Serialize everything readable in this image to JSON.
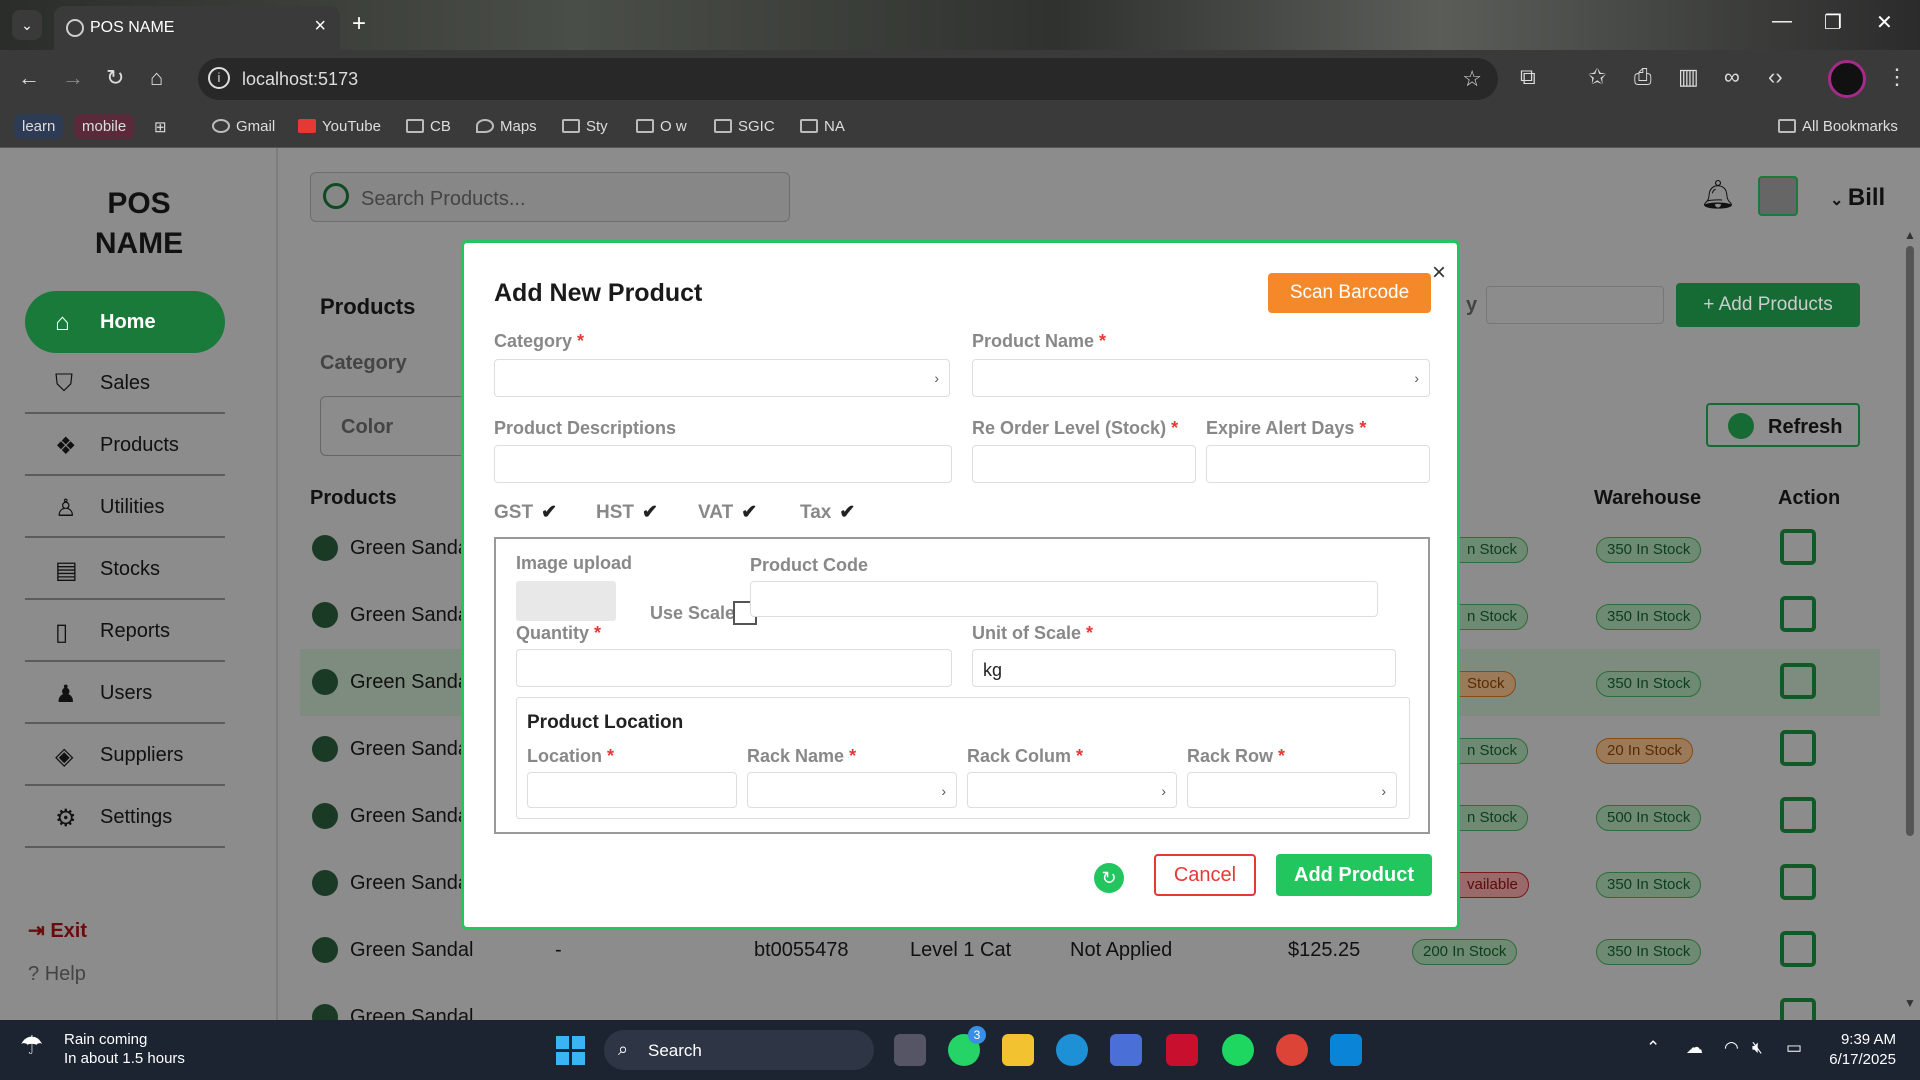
{
  "browser": {
    "tab_title": "POS NAME",
    "url": "localhost:5173",
    "bookmarks": [
      "learn",
      "mobile",
      "Gmail",
      "YouTube",
      "CB",
      "Maps",
      "Sty",
      "O w",
      "SGIC",
      "NA"
    ],
    "all_bookmarks": "All Bookmarks"
  },
  "app": {
    "logo": "POS NAME",
    "search_placeholder": "Search Products...",
    "user": "Bill",
    "nav": [
      "Home",
      "Sales",
      "Products",
      "Utilities",
      "Stocks",
      "Reports",
      "Users",
      "Suppliers",
      "Settings"
    ],
    "exit": "Exit",
    "help": "Help",
    "products_title": "Products",
    "category_label": "Category",
    "color_label": "Color",
    "add_products": "+ Add Products",
    "refresh": "Refresh",
    "filter_suffix": "y",
    "table": {
      "headers": {
        "products": "Products",
        "warehouse": "Warehouse",
        "action": "Action"
      },
      "rows": [
        {
          "name": "Green Sanda",
          "stock": "n Stock",
          "stock_status": "ok",
          "warehouse": "350 In Stock",
          "wh_status": "ok"
        },
        {
          "name": "Green Sanda",
          "stock": "n Stock",
          "stock_status": "ok",
          "warehouse": "350 In Stock",
          "wh_status": "ok"
        },
        {
          "name": "Green Sanda",
          "stock": "Stock",
          "stock_status": "warn",
          "warehouse": "350 In Stock",
          "wh_status": "ok"
        },
        {
          "name": "Green Sanda",
          "stock": "n Stock",
          "stock_status": "ok",
          "warehouse": "20 In Stock",
          "wh_status": "warn"
        },
        {
          "name": "Green Sanda",
          "stock": "n Stock",
          "stock_status": "ok",
          "warehouse": "500 In Stock",
          "wh_status": "ok"
        },
        {
          "name": "Green Sanda",
          "stock": "vailable",
          "stock_status": "bad",
          "warehouse": "350 In Stock",
          "wh_status": "ok"
        },
        {
          "name": "Green Sandal",
          "stock": "200 In Stock",
          "stock_status": "ok",
          "warehouse": "350 In Stock",
          "wh_status": "ok",
          "desc": "-",
          "code": "bt0055478",
          "category": "Level 1 Cat",
          "tax": "Not Applied",
          "price": "$125.25"
        },
        {
          "name": "Green Sandal"
        }
      ]
    }
  },
  "modal": {
    "title": "Add New Product",
    "scan_barcode": "Scan Barcode",
    "close": "×",
    "fields": {
      "category": "Category",
      "product_name": "Product Name",
      "descriptions": "Product Descriptions",
      "reorder": "Re Order Level (Stock)",
      "expire": "Expire Alert Days",
      "image_upload": "Image upload",
      "use_scale": "Use Scale",
      "product_code": "Product Code",
      "quantity": "Quantity",
      "unit_of_scale": "Unit of Scale",
      "unit_value": "kg",
      "location_title": "Product Location",
      "location": "Location",
      "rack_name": "Rack Name",
      "rack_colum": "Rack Colum",
      "rack_row": "Rack Row"
    },
    "required_mark": "*",
    "taxes": [
      "GST",
      "HST",
      "VAT",
      "Tax"
    ],
    "tick": "✔",
    "cancel": "Cancel",
    "add_product": "Add Product"
  },
  "taskbar": {
    "weather_line1": "Rain coming",
    "weather_line2": "In about 1.5 hours",
    "search": "Search",
    "whatsapp_badge": "3",
    "time": "9:39 AM",
    "date": "6/17/2025"
  },
  "colors": {
    "accent_green": "#22c55e",
    "scan_orange": "#f5892a",
    "danger_red": "#e53935"
  }
}
